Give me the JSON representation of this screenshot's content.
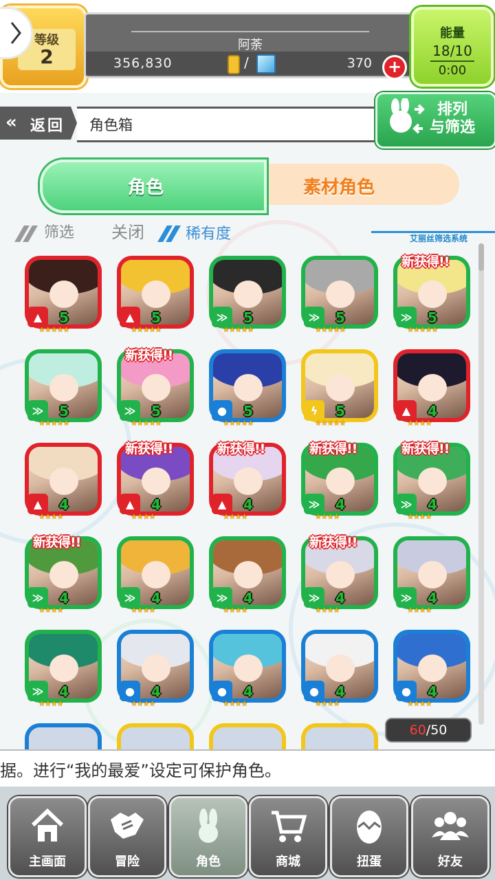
{
  "header": {
    "level_label": "等级",
    "level_value": "2",
    "player_name": "阿荼",
    "gold": "356,830",
    "currency_separator": "/",
    "gems": "370",
    "energy_label": "能量",
    "energy_value": "18/10",
    "energy_timer": "0:00"
  },
  "nav": {
    "back_label": "返回",
    "page_title": "角色箱",
    "sort_filter_label_1": "排列",
    "sort_filter_label_2": "与筛选"
  },
  "tabs": {
    "characters": "角色",
    "materials": "素材角色"
  },
  "filter": {
    "filter_label": "筛选",
    "state_label": "关闭",
    "sort_key_label": "稀有度",
    "system_label": "艾丽丝筛选系统"
  },
  "colors": {
    "fire": "#e0232b",
    "wind": "#22b24c",
    "water": "#1a7fd6",
    "thunder": "#f2c61a"
  },
  "new_badge_label": "新获得!!",
  "characters": [
    {
      "element": "fire",
      "level": "5",
      "stars": 5,
      "new": false,
      "hair": "#3a1f1a"
    },
    {
      "element": "fire",
      "level": "5",
      "stars": 5,
      "new": false,
      "hair": "#f2c231"
    },
    {
      "element": "wind",
      "level": "5",
      "stars": 5,
      "new": false,
      "hair": "#2a2a2a"
    },
    {
      "element": "wind",
      "level": "5",
      "stars": 5,
      "new": false,
      "hair": "#a9a9a9"
    },
    {
      "element": "wind",
      "level": "5",
      "stars": 5,
      "new": true,
      "hair": "#f3e58a"
    },
    {
      "element": "wind",
      "level": "5",
      "stars": 5,
      "new": false,
      "hair": "#bfeee0"
    },
    {
      "element": "wind",
      "level": "5",
      "stars": 5,
      "new": true,
      "hair": "#f39ac7"
    },
    {
      "element": "water",
      "level": "5",
      "stars": 5,
      "new": false,
      "hair": "#2b3fa8"
    },
    {
      "element": "thunder",
      "level": "5",
      "stars": 5,
      "new": false,
      "hair": "#f7eac3"
    },
    {
      "element": "fire",
      "level": "4",
      "stars": 4,
      "new": false,
      "hair": "#1e1a2e"
    },
    {
      "element": "fire",
      "level": "4",
      "stars": 4,
      "new": false,
      "hair": "#f1dcc1"
    },
    {
      "element": "fire",
      "level": "4",
      "stars": 4,
      "new": true,
      "hair": "#7a4bc2"
    },
    {
      "element": "fire",
      "level": "4",
      "stars": 4,
      "new": true,
      "hair": "#e6d5ef"
    },
    {
      "element": "wind",
      "level": "4",
      "stars": 4,
      "new": true,
      "hair": "#35a84c"
    },
    {
      "element": "wind",
      "level": "4",
      "stars": 4,
      "new": true,
      "hair": "#3fae5a"
    },
    {
      "element": "wind",
      "level": "4",
      "stars": 4,
      "new": true,
      "hair": "#4e9a3d"
    },
    {
      "element": "wind",
      "level": "4",
      "stars": 4,
      "new": false,
      "hair": "#f0b43a"
    },
    {
      "element": "wind",
      "level": "4",
      "stars": 4,
      "new": false,
      "hair": "#a86a3a"
    },
    {
      "element": "wind",
      "level": "4",
      "stars": 4,
      "new": true,
      "hair": "#d8d8e6"
    },
    {
      "element": "wind",
      "level": "4",
      "stars": 4,
      "new": false,
      "hair": "#c9cbe0"
    },
    {
      "element": "wind",
      "level": "4",
      "stars": 4,
      "new": false,
      "hair": "#1f8a6a"
    },
    {
      "element": "water",
      "level": "4",
      "stars": 4,
      "new": false,
      "hair": "#e4e8ee"
    },
    {
      "element": "water",
      "level": "4",
      "stars": 4,
      "new": false,
      "hair": "#56c3dc"
    },
    {
      "element": "water",
      "level": "4",
      "stars": 4,
      "new": false,
      "hair": "#f2f2f2"
    },
    {
      "element": "water",
      "level": "4",
      "stars": 4,
      "new": false,
      "hair": "#2f6fd0"
    }
  ],
  "partial_row_frames": [
    "water",
    "thunder",
    "thunder",
    "thunder"
  ],
  "count": {
    "current": "60",
    "separator": "/",
    "max": "50"
  },
  "ticker": "据。进行“我的最爱”设定可保护角色。",
  "bottom_nav": [
    {
      "label": "主画面",
      "icon": "home-icon"
    },
    {
      "label": "冒险",
      "icon": "handshake-icon"
    },
    {
      "label": "角色",
      "icon": "rabbit-icon"
    },
    {
      "label": "商城",
      "icon": "cart-icon"
    },
    {
      "label": "扭蛋",
      "icon": "egg-icon"
    },
    {
      "label": "好友",
      "icon": "friends-icon"
    }
  ]
}
